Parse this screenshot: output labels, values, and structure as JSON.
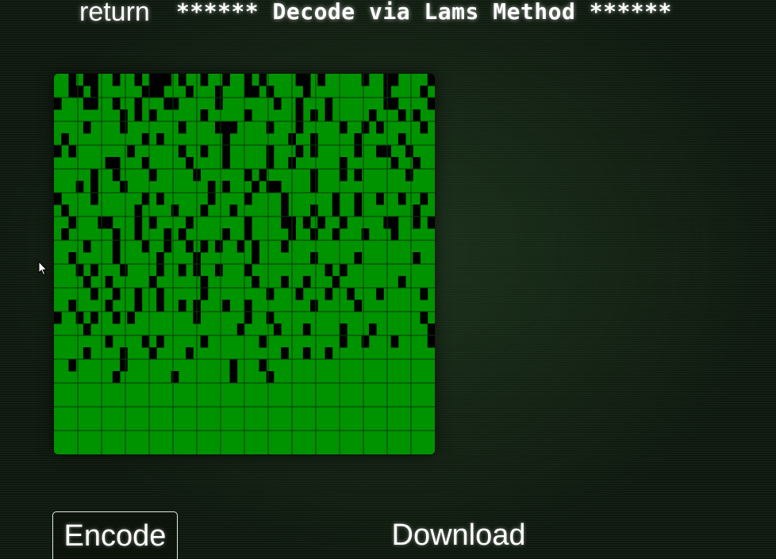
{
  "header": {
    "return_label": "return",
    "title": "****** Decode via Lams Method ******"
  },
  "grid": {
    "rows": 16,
    "cols": 16,
    "subdivisions": 2,
    "on_color": "#009300",
    "off_color": "#000000",
    "line_color": "#0a3a0a",
    "bitmap": [
      "1101001101101000101101101101011110010111110110011110",
      "1100101111110001110111011100101111011111111110111101",
      "0111001101101110011111011111110110111011111110011110",
      "1111111110101011111101111101111110101011111011101011",
      "1111011110111111101111000111101110111110110101111101",
      "1011111111110101111111101111111101101111101111101111",
      "0101111111011111101101101111101110101111101100110111",
      "1111111001110111110111101111101101111110111111011011",
      "1111101101111011111011111101011111101110101111110111",
      "1110101110111111111110101110100111101111111111111111",
      "0111101111110101111110111101111011111101101101101101",
      "1011111111101111011101110111111011101101101111111011",
      "1101110011101011110111111101111001010110111110011010",
      "1011111101101110101111101101111101101101110111011111",
      "1111011101110110110101011010111011111111111111111111",
      "1101111101111101111011111110111111101111101111111011",
      "1110101110111101101011011101111111111010111111111111",
      "1111011011111011111101111110111011011101111111101111",
      "1111101101101101111101111111101110111011011101111101",
      "1101111011101101101011101101111111101111101111111111",
      "0110101101011111111011111101101111111111111111111101",
      "1111011111111111111111111011110111011110111011111110",
      "1111111011110101111101111111011111111110110111011110",
      "1111011110111011110111111111111011011011111111111111",
      "1101111110111111111111110111011111111111111111111111",
      "1111111101111111011111110111101111111111111111111111",
      "1111111111111111111111111111111111111111111111111111",
      "1111111111111111111111111111111111111111111111111111",
      "1111111111111111111111111111111111111111111111111111",
      "1111111111111111111111111111111111111111111111111111",
      "1111111111111111111111111111111111111111111111111111",
      "1111111111111111111111111111111111111111111111111111"
    ]
  },
  "footer": {
    "encode_label": "Encode",
    "download_label": "Download"
  },
  "icons": {
    "cursor": "mouse-pointer-icon"
  }
}
